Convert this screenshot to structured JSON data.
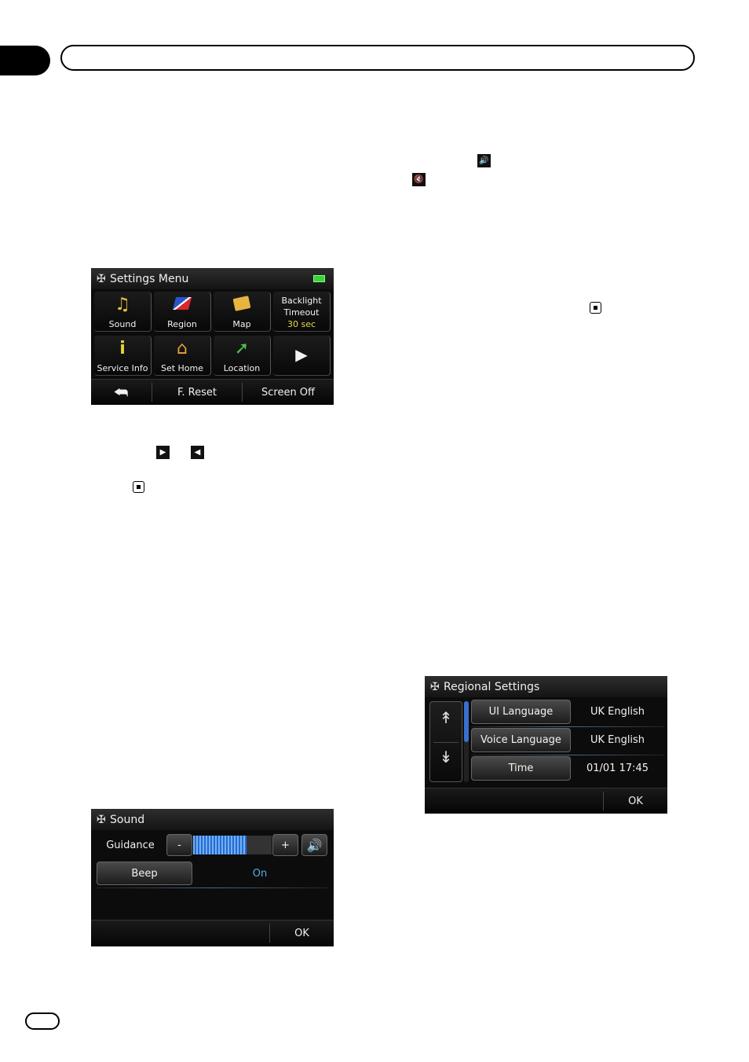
{
  "settings_menu": {
    "title": "Settings Menu",
    "tiles": [
      {
        "label": "Sound",
        "icon": "sound-icon"
      },
      {
        "label": "Region",
        "icon": "region-icon"
      },
      {
        "label": "Map",
        "icon": "map-icon"
      },
      {
        "label": "Service Info",
        "icon": "service-info-icon"
      },
      {
        "label": "Set Home",
        "icon": "set-home-icon"
      },
      {
        "label": "Location",
        "icon": "location-icon"
      }
    ],
    "backlight": {
      "line1": "Backlight",
      "line2": "Timeout",
      "value": "30 sec"
    },
    "bottom": {
      "reset": "F. Reset",
      "screen_off": "Screen Off"
    }
  },
  "sound_screen": {
    "title": "Sound",
    "guidance_label": "Guidance",
    "minus": "-",
    "plus": "+",
    "volume_level": 0.68,
    "beep_label": "Beep",
    "beep_value": "On",
    "ok": "OK"
  },
  "regional_screen": {
    "title": "Regional Settings",
    "rows": [
      {
        "label": "UI Language",
        "value": "UK English"
      },
      {
        "label": "Voice Language",
        "value": "UK English"
      },
      {
        "label": "Time",
        "value": "01/01 17:45"
      }
    ],
    "ok": "OK"
  },
  "colors": {
    "accent_blue": "#3a6fd0",
    "backlight_value": "#e6d845",
    "beep_on": "#4fb0e8"
  }
}
